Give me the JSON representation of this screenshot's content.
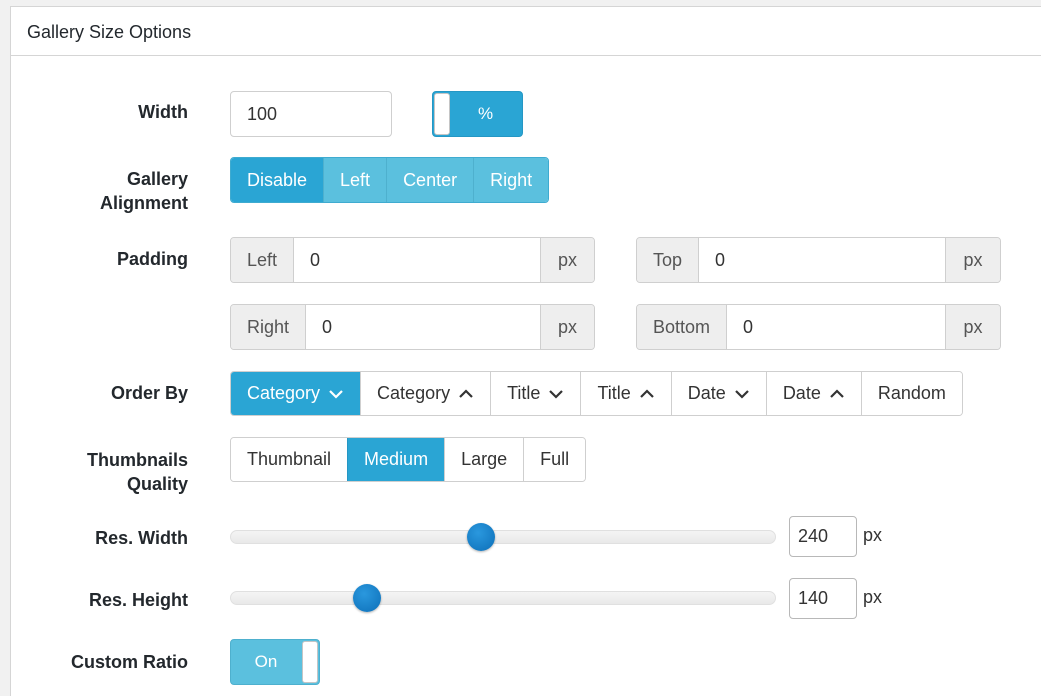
{
  "panel": {
    "title": "Gallery Size Options"
  },
  "width": {
    "label": "Width",
    "value": "100",
    "unit_toggle": "%"
  },
  "alignment": {
    "label_line1": "Gallery",
    "label_line2": "Alignment",
    "options": [
      "Disable",
      "Left",
      "Center",
      "Right"
    ],
    "selected": "Disable"
  },
  "padding": {
    "label": "Padding",
    "left": {
      "label": "Left",
      "value": "0",
      "unit": "px"
    },
    "top": {
      "label": "Top",
      "value": "0",
      "unit": "px"
    },
    "right": {
      "label": "Right",
      "value": "0",
      "unit": "px"
    },
    "bottom": {
      "label": "Bottom",
      "value": "0",
      "unit": "px"
    }
  },
  "order_by": {
    "label": "Order By",
    "options": [
      {
        "label": "Category",
        "arrow": "down"
      },
      {
        "label": "Category",
        "arrow": "up"
      },
      {
        "label": "Title",
        "arrow": "down"
      },
      {
        "label": "Title",
        "arrow": "up"
      },
      {
        "label": "Date",
        "arrow": "down"
      },
      {
        "label": "Date",
        "arrow": "up"
      },
      {
        "label": "Random",
        "arrow": ""
      }
    ],
    "selected_index": 0
  },
  "thumb_quality": {
    "label_line1": "Thumbnails",
    "label_line2": "Quality",
    "options": [
      "Thumbnail",
      "Medium",
      "Large",
      "Full"
    ],
    "selected": "Medium"
  },
  "res_width": {
    "label": "Res. Width",
    "value": "240",
    "unit": "px",
    "fraction": 0.46
  },
  "res_height": {
    "label": "Res. Height",
    "value": "140",
    "unit": "px",
    "fraction": 0.25
  },
  "custom_ratio": {
    "label": "Custom Ratio",
    "toggle": "On"
  },
  "colors": {
    "accent": "#2aa5d4",
    "accent_light": "#5bc0de",
    "slider_knob": "#0d6fb8"
  }
}
